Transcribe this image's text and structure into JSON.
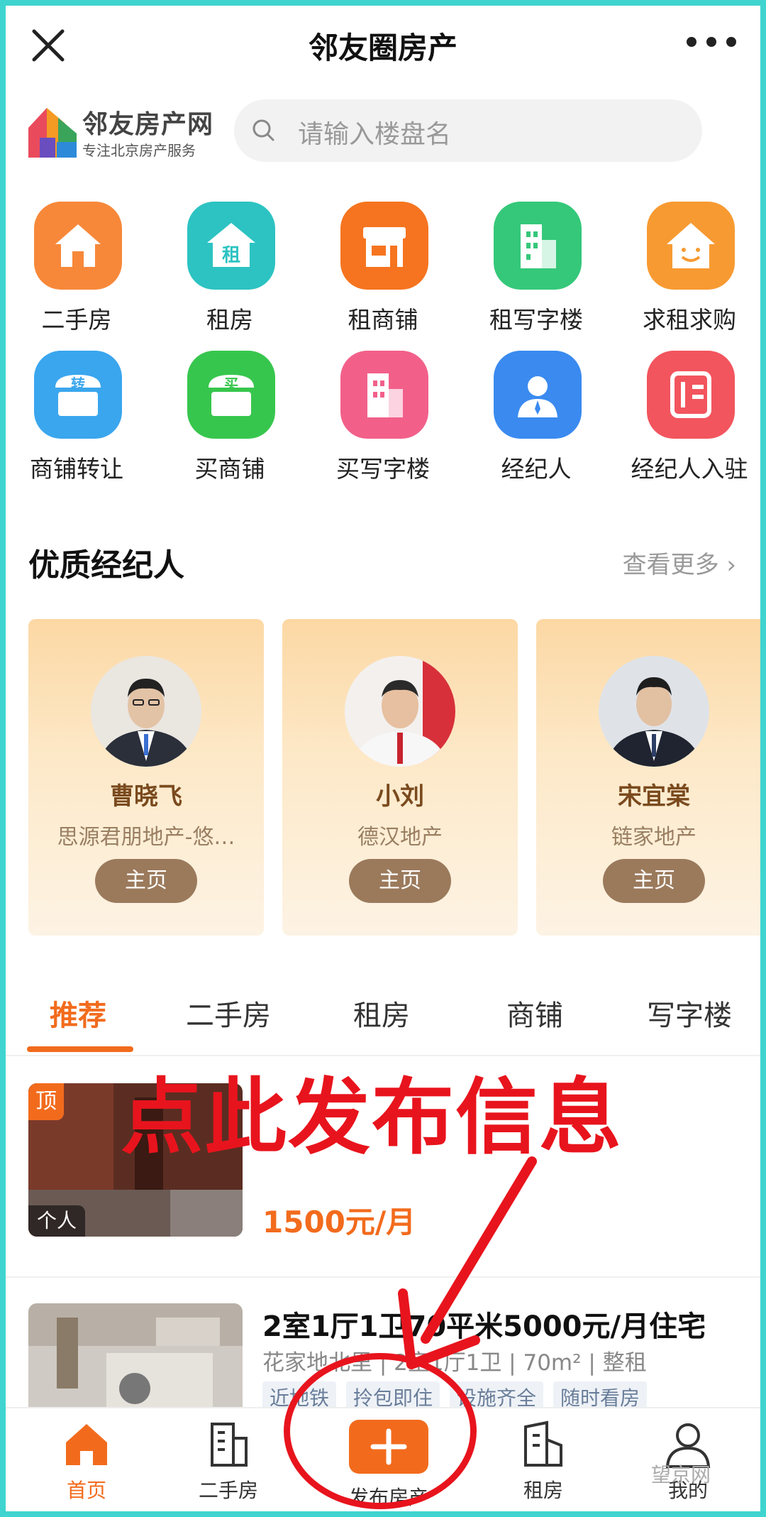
{
  "header": {
    "title": "邻友圈房产",
    "close_icon": "close-icon",
    "more_icon": "more-dots-icon"
  },
  "brand": {
    "name": "邻友房产网",
    "slogan": "专注北京房产服务"
  },
  "search": {
    "placeholder": "请输入楼盘名"
  },
  "categories": [
    {
      "label": "二手房",
      "icon": "house-icon",
      "color": "#f7883a"
    },
    {
      "label": "租房",
      "icon": "rent-house-icon",
      "color": "#2cc3c2",
      "glyph": "租"
    },
    {
      "label": "租商铺",
      "icon": "shop-icon",
      "color": "#f6741f"
    },
    {
      "label": "租写字楼",
      "icon": "office-building-icon",
      "color": "#35c87a"
    },
    {
      "label": "求租求购",
      "icon": "smiley-house-icon",
      "color": "#f79a32"
    },
    {
      "label": "商铺转让",
      "icon": "transfer-shop-icon",
      "color": "#3aa6ee",
      "glyph": "转"
    },
    {
      "label": "买商铺",
      "icon": "buy-shop-icon",
      "color": "#37c64d",
      "glyph": "买"
    },
    {
      "label": "买写字楼",
      "icon": "buy-office-icon",
      "color": "#f2608a"
    },
    {
      "label": "经纪人",
      "icon": "agent-icon",
      "color": "#3a8af0"
    },
    {
      "label": "经纪人入驻",
      "icon": "agent-join-icon",
      "color": "#f2555e"
    }
  ],
  "agents_section": {
    "title": "优质经纪人",
    "more": "查看更多 ›"
  },
  "agents": [
    {
      "name": "曹晓飞",
      "company": "思源君朋地产-悠…",
      "button": "主页"
    },
    {
      "name": "小刘",
      "company": "德汉地产",
      "button": "主页"
    },
    {
      "name": "宋宜棠",
      "company": "链家地产",
      "button": "主页"
    }
  ],
  "tabs": [
    "推荐",
    "二手房",
    "租房",
    "商铺",
    "写字楼"
  ],
  "listings": [
    {
      "badge_top": "顶",
      "badge_owner": "个人",
      "price": "1500元/月"
    },
    {
      "title": "2室1厅1卫70平米5000元/月住宅",
      "meta": "花家地北里 | 2室1厅1卫 | 70m² | 整租",
      "tags": [
        "近地铁",
        "拎包即住",
        "设施齐全",
        "随时看房"
      ]
    }
  ],
  "promo": {
    "text": "点此发布信息"
  },
  "bottom_nav": [
    {
      "label": "首页",
      "icon": "home-icon"
    },
    {
      "label": "二手房",
      "icon": "building-icon"
    },
    {
      "label": "发布房产",
      "icon": "plus-icon"
    },
    {
      "label": "租房",
      "icon": "rent-building-icon"
    },
    {
      "label": "我的",
      "icon": "user-icon"
    }
  ],
  "watermark": "望京网",
  "colors": {
    "accent": "#f26b1d",
    "promo_red": "#e8141d",
    "frame": "#3fd4cf"
  }
}
